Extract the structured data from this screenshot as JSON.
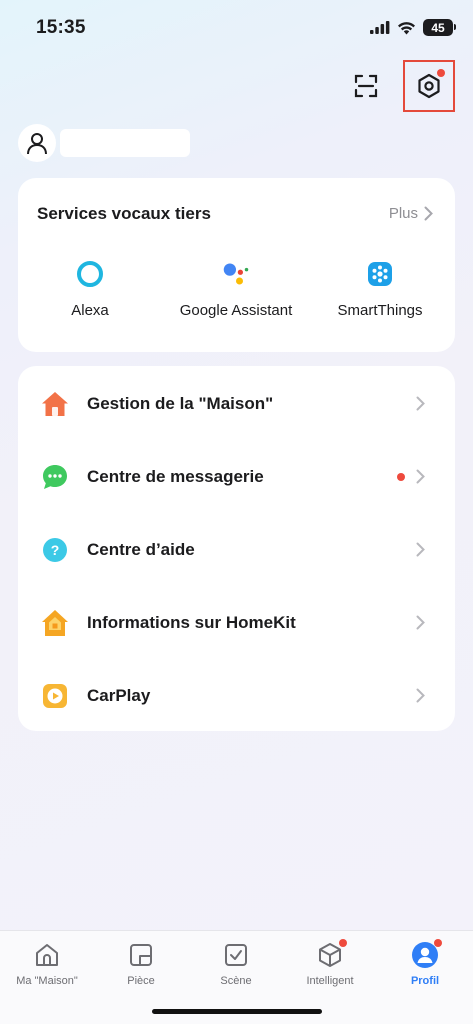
{
  "status_bar": {
    "time": "15:35",
    "battery": "45"
  },
  "voice_services": {
    "title": "Services vocaux tiers",
    "more_label": "Plus",
    "items": [
      {
        "label": "Alexa",
        "icon": "alexa-icon"
      },
      {
        "label": "Google Assistant",
        "icon": "google-assistant-icon"
      },
      {
        "label": "SmartThings",
        "icon": "smartthings-icon"
      }
    ]
  },
  "menu": {
    "items": [
      {
        "label": "Gestion de la \"Maison\"",
        "icon": "home-icon",
        "badge": false
      },
      {
        "label": "Centre de messagerie",
        "icon": "message-icon",
        "badge": true
      },
      {
        "label": "Centre d’aide",
        "icon": "help-icon",
        "badge": false
      },
      {
        "label": "Informations sur HomeKit",
        "icon": "homekit-icon",
        "badge": false
      },
      {
        "label": "CarPlay",
        "icon": "carplay-icon",
        "badge": false
      }
    ]
  },
  "tabs": [
    {
      "label": "Ma \"Maison\"",
      "icon": "house-icon",
      "active": false
    },
    {
      "label": "Pièce",
      "icon": "room-icon",
      "active": false
    },
    {
      "label": "Scène",
      "icon": "scene-icon",
      "active": false
    },
    {
      "label": "Intelligent",
      "icon": "smart-icon",
      "active": false,
      "badge": true
    },
    {
      "label": "Profil",
      "icon": "profile-icon",
      "active": true
    }
  ],
  "colors": {
    "accent": "#2f7ef6",
    "badge": "#ee4a3d",
    "highlight_box": "#e4493a",
    "home_icon": "#f27247",
    "message_icon": "#3fc95f",
    "help_icon": "#3cc9e6",
    "homekit_icon": "#f5a623",
    "carplay_icon": "#f7b634",
    "alexa": "#1fb6e0",
    "smartthings": "#1da0e8"
  }
}
